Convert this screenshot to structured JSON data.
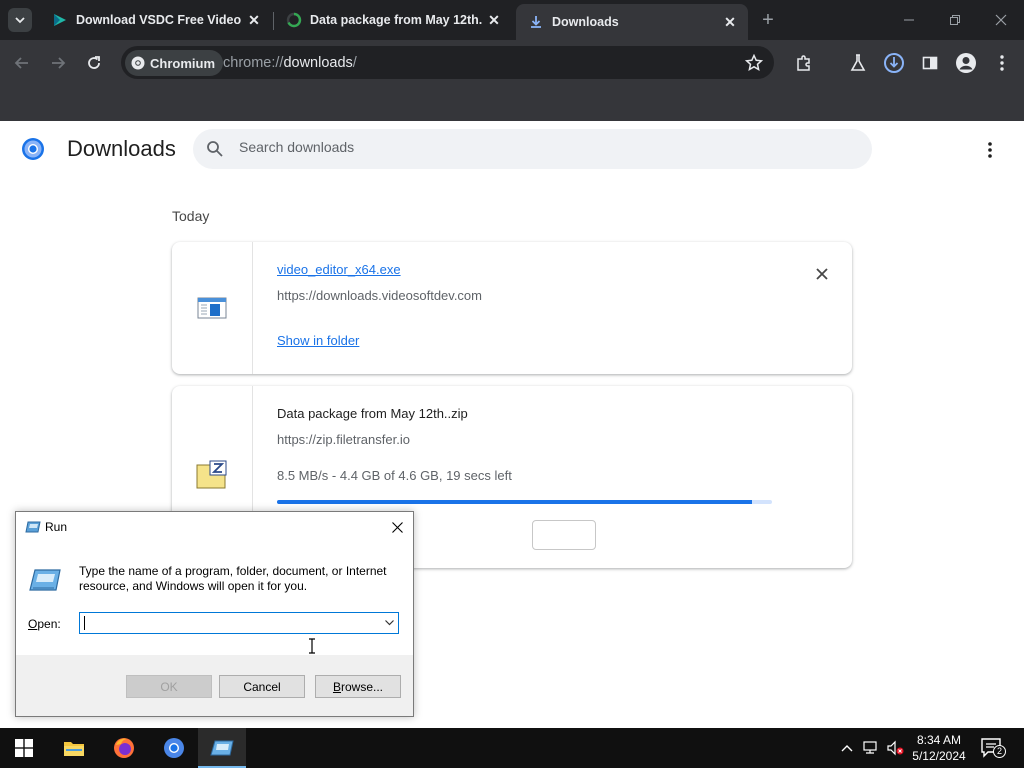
{
  "browser": {
    "tabs": [
      {
        "title": "Download VSDC Free Video Ed",
        "active": false
      },
      {
        "title": "Data package from May 12th.",
        "active": false
      },
      {
        "title": "Downloads",
        "active": true
      }
    ],
    "site_chip": "Chromium",
    "url_prefix": "chrome://",
    "url_host": "downloads",
    "url_suffix": "/"
  },
  "downloads_page": {
    "title": "Downloads",
    "search_placeholder": "Search downloads",
    "date_header": "Today",
    "items": [
      {
        "filename": "video_editor_x64.exe",
        "source": "https://downloads.videosoftdev.com",
        "action": "Show in folder"
      },
      {
        "filename": "Data package from May 12th..zip",
        "source": "https://zip.filetransfer.io",
        "status": "8.5 MB/s - 4.4 GB of 4.6 GB, 19 secs left",
        "progress": 0.96
      }
    ]
  },
  "run_dialog": {
    "title": "Run",
    "description": "Type the name of a program, folder, document, or Internet resource, and Windows will open it for you.",
    "open_label_accel": "O",
    "open_label_rest": "pen:",
    "input_value": "",
    "ok_label": "OK",
    "cancel_label": "Cancel",
    "browse_accel": "B",
    "browse_rest": "rowse..."
  },
  "taskbar": {
    "time": "8:34 AM",
    "date": "5/12/2024",
    "notification_count": "2"
  },
  "colors": {
    "accent": "#1a73e8",
    "chrome_dark": "#202124",
    "toolbar": "#35363a"
  }
}
